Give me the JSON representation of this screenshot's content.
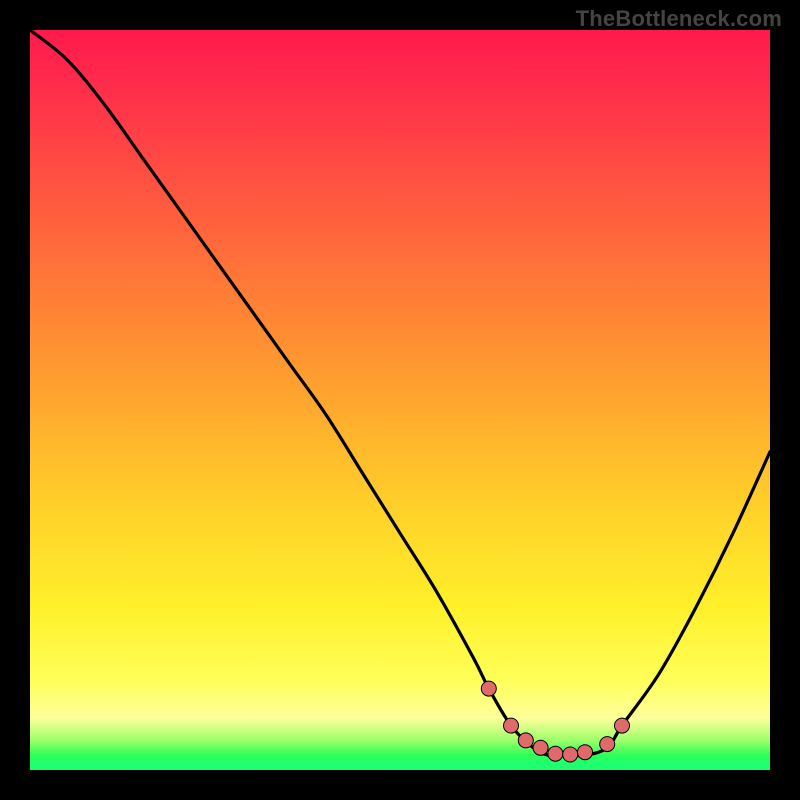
{
  "watermark": "TheBottleneck.com",
  "colors": {
    "background": "#000000",
    "curve_stroke": "#000000",
    "marker_fill": "#e06a6a",
    "marker_stroke": "#000000"
  },
  "chart_data": {
    "type": "line",
    "title": "",
    "xlabel": "",
    "ylabel": "",
    "xlim": [
      0,
      100
    ],
    "ylim": [
      0,
      100
    ],
    "grid": false,
    "legend": null,
    "series": [
      {
        "name": "bottleneck-curve",
        "x": [
          0,
          5,
          10,
          15,
          20,
          25,
          30,
          35,
          40,
          45,
          50,
          55,
          60,
          62,
          65,
          68,
          70,
          72,
          75,
          78,
          80,
          85,
          90,
          95,
          100
        ],
        "values": [
          100,
          96,
          90,
          83,
          76,
          69,
          62,
          55,
          48,
          40,
          32,
          24,
          15,
          11,
          6,
          3,
          2,
          2,
          2,
          3,
          6,
          13,
          22,
          32,
          43
        ]
      }
    ],
    "markers": {
      "name": "highlight-points",
      "x": [
        62,
        65,
        67,
        69,
        71,
        73,
        75,
        78,
        80
      ],
      "values": [
        11,
        6,
        4,
        3,
        2.2,
        2.1,
        2.4,
        3.5,
        6
      ]
    }
  }
}
